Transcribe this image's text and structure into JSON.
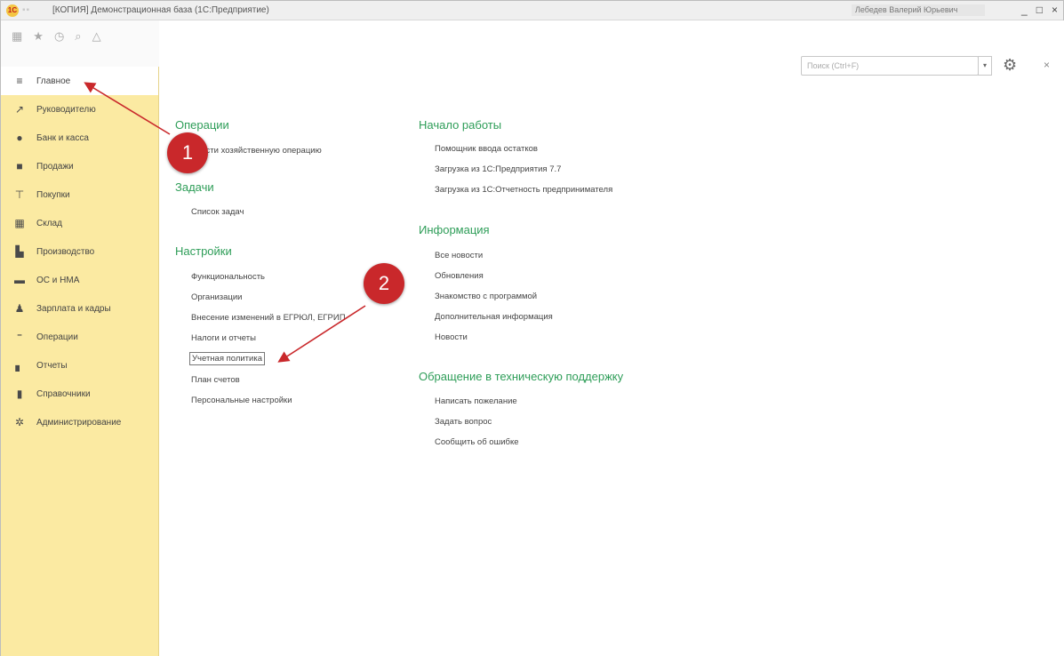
{
  "window": {
    "title": "[КОПИЯ] Демонстрационная база (1С:Предприятие)",
    "user": "Лебедев Валерий Юрьевич",
    "controls": [
      "_",
      "□",
      "×"
    ]
  },
  "panel_toolbar": {
    "icons": [
      "apps-icon",
      "star-icon",
      "history-icon",
      "search-icon",
      "bell-icon"
    ]
  },
  "sidebar": {
    "items": [
      {
        "label": "Главное",
        "icon": "menu-icon",
        "glyph": "≡",
        "active": true
      },
      {
        "label": "Руководителю",
        "icon": "trend-icon",
        "glyph": "↗",
        "active": false
      },
      {
        "label": "Банк и касса",
        "icon": "bank-icon",
        "glyph": "●",
        "active": false
      },
      {
        "label": "Продажи",
        "icon": "bag-icon",
        "glyph": "■",
        "active": false
      },
      {
        "label": "Покупки",
        "icon": "cart-icon",
        "glyph": "⊤",
        "active": false
      },
      {
        "label": "Склад",
        "icon": "warehouse-icon",
        "glyph": "▦",
        "active": false
      },
      {
        "label": "Производство",
        "icon": "factory-icon",
        "glyph": "▙",
        "active": false
      },
      {
        "label": "ОС и НМА",
        "icon": "truck-icon",
        "glyph": "▬",
        "active": false
      },
      {
        "label": "Зарплата и кадры",
        "icon": "person-icon",
        "glyph": "♟",
        "active": false
      },
      {
        "label": "Операции",
        "icon": "operations-icon",
        "glyph": "⁼",
        "active": false
      },
      {
        "label": "Отчеты",
        "icon": "report-icon",
        "glyph": "▖",
        "active": false
      },
      {
        "label": "Справочники",
        "icon": "book-icon",
        "glyph": "▮",
        "active": false
      },
      {
        "label": "Администрирование",
        "icon": "admin-gear-icon",
        "glyph": "✲",
        "active": false
      }
    ]
  },
  "search": {
    "placeholder": "Поиск (Ctrl+F)"
  },
  "sections": {
    "operations": {
      "title": "Операции",
      "links": [
        "Ввести хозяйственную операцию"
      ]
    },
    "tasks": {
      "title": "Задачи",
      "links": [
        "Список задач"
      ]
    },
    "settings": {
      "title": "Настройки",
      "links": [
        "Функциональность",
        "Организации",
        "Внесение изменений в ЕГРЮЛ, ЕГРИП",
        "Налоги и отчеты",
        "Учетная политика",
        "План счетов",
        "Персональные настройки"
      ]
    },
    "getting_started": {
      "title": "Начало работы",
      "links": [
        "Помощник ввода остатков",
        "Загрузка из 1С:Предприятия 7.7",
        "Загрузка из 1С:Отчетность предпринимателя"
      ]
    },
    "information": {
      "title": "Информация",
      "links": [
        "Все новости",
        "Обновления",
        "Знакомство с программой",
        "Дополнительная информация",
        "Новости"
      ]
    },
    "support": {
      "title": "Обращение в техническую поддержку",
      "links": [
        "Написать пожелание",
        "Задать вопрос",
        "Сообщить об ошибке"
      ]
    }
  },
  "annotations": {
    "marker1": "1",
    "marker2": "2",
    "color": "#c9282b"
  }
}
